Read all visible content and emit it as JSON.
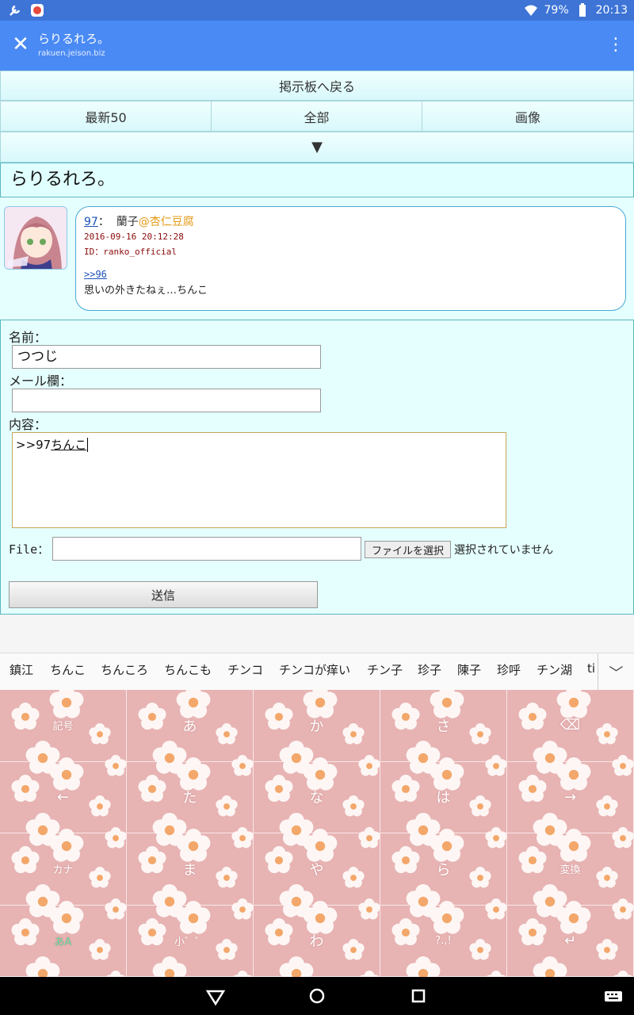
{
  "status_bar": {
    "battery": "79%",
    "time": "20:13",
    "icons": [
      "wrench-icon",
      "app-notification-icon",
      "wifi-icon",
      "battery-icon"
    ]
  },
  "toolbar": {
    "title": "らりるれろ。",
    "url": "rakuen.jeison.biz",
    "close_icon": "close-icon",
    "menu_icon": "more-vert-icon"
  },
  "nav": {
    "back": "掲示板へ戻る",
    "latest50": "最新50",
    "all": "全部",
    "images": "画像",
    "expand": "▼"
  },
  "thread": {
    "title": "らりるれろ。"
  },
  "post": {
    "number": "97",
    "colon": "：",
    "name": "蘭子",
    "trip": "@杏仁豆腐",
    "date": "2016-09-16 20:12:28",
    "id": "ID：ranko_official",
    "anchor": ">>96",
    "body": "思いの外きたねぇ…ちんこ"
  },
  "form": {
    "name_label": "名前：",
    "name_value": "つつじ",
    "mail_label": "メール欄：",
    "mail_value": "",
    "content_label": "内容：",
    "content_prefix": ">>97",
    "content_composing": "ちんこ",
    "file_label": "File：",
    "file_button": "ファイルを選択",
    "file_status": "選択されていません",
    "submit": "送信"
  },
  "suggestions": [
    "鎮江",
    "ちんこ",
    "ちんころ",
    "ちんこも",
    "チンコ",
    "チンコが痒い",
    "チン子",
    "珍子",
    "陳子",
    "珍呼",
    "チン湖",
    "ti"
  ],
  "keyboard": {
    "keys": [
      [
        "記号",
        "あ",
        "か",
        "さ",
        "⌫"
      ],
      [
        "←",
        "た",
        "な",
        "は",
        "→"
      ],
      [
        "カナ",
        "ま",
        "や",
        "ら",
        "変換"
      ],
      [
        "あA",
        "小゛゜",
        "わ",
        "?.,!",
        "↵"
      ]
    ],
    "accent_color": "#e7b3b3"
  }
}
